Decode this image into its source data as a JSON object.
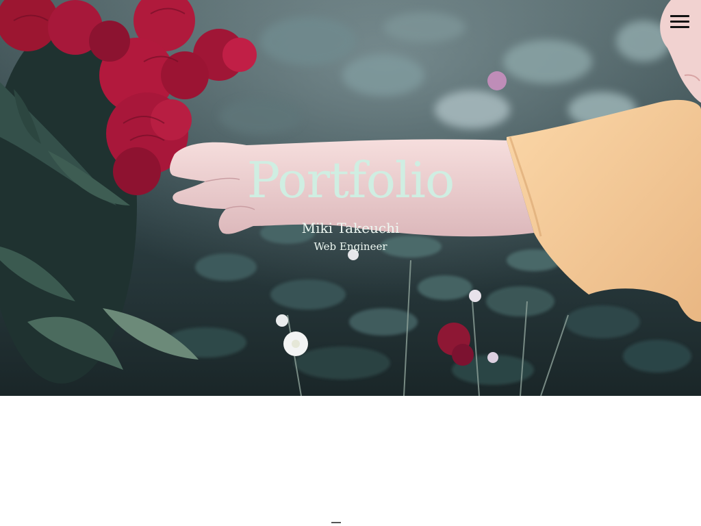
{
  "hero": {
    "title": "Portfolio",
    "name": "Miki Takeuchi",
    "role": "Web Engineer"
  },
  "menu": {
    "icon": "hamburger-menu-icon"
  },
  "colors": {
    "title": "#cfeee2",
    "subtitle": "#eef8f2",
    "background": "#ffffff",
    "menu_icon": "#111111"
  }
}
